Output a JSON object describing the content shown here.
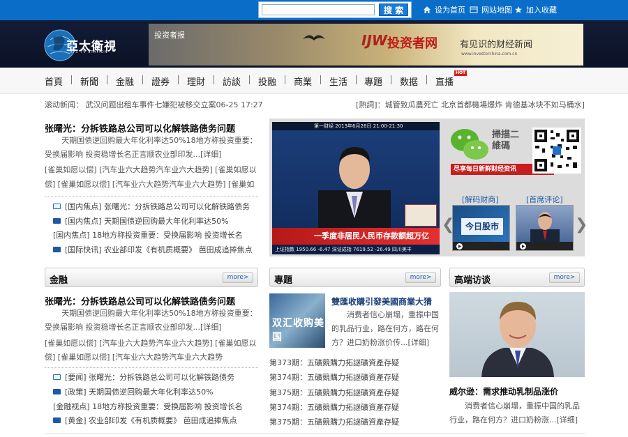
{
  "topbar": {
    "search_placeholder": "",
    "search_button": "搜 索",
    "links": [
      "设为首页",
      "网站地图",
      "加入收藏"
    ]
  },
  "header": {
    "logo_text": "亞太衛視",
    "logo_sub": "APS TV STATION",
    "ad": {
      "small_label": "投资者报",
      "logo_mark": "IJW",
      "title": "投资者网",
      "slogan": "有见识的财经新闻",
      "url": "www.investorchina.com.cn"
    }
  },
  "nav": {
    "items": [
      "首頁",
      "新聞",
      "金融",
      "證券",
      "理財",
      "訪談",
      "投融",
      "商業",
      "生活",
      "專題",
      "数据",
      "直播"
    ],
    "hot_badge": "HOT"
  },
  "ticker": {
    "label": "滚动新闻：",
    "text": "武汉问题出租车事件七嫌犯被移交立案06-25 17:27",
    "hotwords": "[熱詞]：城管致瓜農死亡  北京首都機場爆炸  肯德基冰块不如马桶水]"
  },
  "top_story": {
    "title": "张曙光：分拆铁路总公司可以化解铁路债务问题",
    "para": "天期国债逆回购最大年化利率达50%18地方称投资重要：受换届影响 投资稳增长名正言顺农业部印发...[详细]",
    "tags_line1": "[雀巢如愿以偿] [汽车业六大趋势汽车业六大趋势] [雀巢如愿以",
    "tags_line2": "偿] [雀巢如愿以偿] [汽车业六大趋势汽车业六大趋势] [雀巢如",
    "list": [
      {
        "icon": "mail",
        "text": "[国内焦点] 张曙光：分拆铁路总公司可以化解铁路债务"
      },
      {
        "icon": "tv",
        "text": "[国内焦点] 天期国债逆回购最大年化利率达50%"
      },
      {
        "icon": "none",
        "text": "[国内焦点] 18地方称投资重要：受换届影响 投资增长名"
      },
      {
        "icon": "tv",
        "text": "[国际快讯] 农业部印发《有机质概要》 芭田成追捧焦点"
      }
    ]
  },
  "feature": {
    "video": {
      "bar_text": "第一财经   2013年6月26日 21:00-21:30",
      "caption": "一季度非居民人民币存款额超万亿",
      "ticker": "上证指数 1950.66 -6.47  深证成指 7619.52 -26.49  四川美丰"
    },
    "qr_text": "掃描二維碼",
    "qr_strip": "尽享每日新鲜财经资讯",
    "thumbs": [
      {
        "label": "[解码财商]",
        "caption": "今日股市"
      },
      {
        "label": "[首席评论]",
        "caption": ""
      }
    ]
  },
  "finance": {
    "head": "金融",
    "more": "more>",
    "title": "张曙光：分拆铁路总公司可以化解铁路债务问题",
    "para": "天期国债逆回购最大年化利率达50%18地方称投资重要：受换届影响 投资稳增长名正言顺农业部印发...[详细]",
    "tags_line1": "[雀巢如愿以偿] [汽车业六大趋势汽车业六大趋势] [雀巢如愿以",
    "tags_line2": "偿] [雀巢如愿以偿] [汽车业六大趋势汽车业六大趋势",
    "list": [
      {
        "icon": "mail",
        "text": "[要闻] 张曙光：分拆铁路总公司可以化解铁路债务"
      },
      {
        "icon": "tv",
        "text": "[政策] 天期国债逆回购最大年化利率达50%"
      },
      {
        "icon": "none",
        "text": "[金融视点] 18地方称投资重要：受换届影响 投资增长名"
      },
      {
        "icon": "tv",
        "text": "[黄金] 农业部印发《有机质概要》 芭田成追捧焦点"
      }
    ]
  },
  "special": {
    "head": "專題",
    "more": "more>",
    "img_text": "双汇收购美国",
    "title": "雙匯收購引發美國商業大猜",
    "desc": "消费者信心崩塌，重振中国的乳品行业，路在何方，路在何方？进口奶粉涨价传...[详细]",
    "issues": [
      "第373期：五礦競購力拓謎礦資產存疑",
      "第374期：五礦競購力拓謎礦資產存疑",
      "第375期：五礦競購力拓謎礦資產存疑",
      "第374期：五礦競購力拓謎礦資產存疑",
      "第375期：五礦競購力拓謎礦資產存疑"
    ]
  },
  "interview": {
    "head": "高端访谈",
    "more": "more>",
    "title": "威尔逊：需求推动乳制品涨价",
    "desc": "消费者信心崩塌，重振中国的乳品行业，路在何方？进口奶粉涨...[详细]"
  },
  "colors": {
    "topbar": "#0a6ec9",
    "header": "#131c37",
    "link_blue": "#1f5aa8",
    "red": "#c71f1f"
  }
}
